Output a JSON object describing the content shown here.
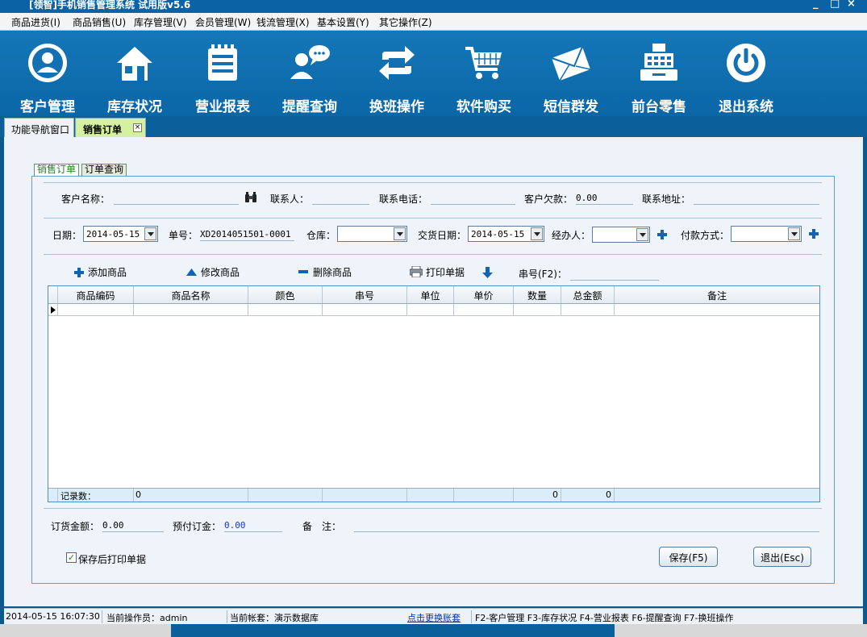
{
  "window": {
    "title": "[领智]手机销售管理系统 试用版v5.6",
    "controls": [
      "_",
      "□",
      "×"
    ]
  },
  "menu": [
    "商品进货(I)",
    "商品销售(U)",
    "库存管理(V)",
    "会员管理(W)",
    "钱流管理(X)",
    "基本设置(Y)",
    "其它操作(Z)"
  ],
  "toolbar": [
    {
      "label": "客户管理",
      "icon": "user-icon"
    },
    {
      "label": "库存状况",
      "icon": "home-icon"
    },
    {
      "label": "营业报表",
      "icon": "notebook-icon"
    },
    {
      "label": "提醒查询",
      "icon": "chat-user-icon"
    },
    {
      "label": "换班操作",
      "icon": "swap-icon"
    },
    {
      "label": "软件购买",
      "icon": "cart-icon"
    },
    {
      "label": "短信群发",
      "icon": "envelope-icon"
    },
    {
      "label": "前台零售",
      "icon": "cash-register-icon"
    },
    {
      "label": "退出系统",
      "icon": "power-icon"
    }
  ],
  "tabs": {
    "nav": "功能导航窗口",
    "active": "销售订单",
    "close": "×"
  },
  "inner_tabs": [
    "销售订单",
    "订单查询"
  ],
  "customer_row": {
    "customer_name_label": "客户名称：",
    "contact_label": "联系人：",
    "phone_label": "联系电话：",
    "debt_label": "客户欠款：",
    "debt_value": "0.00",
    "address_label": "联系地址："
  },
  "order_row": {
    "date_label": "日期：",
    "date_value": "2014-05-15",
    "order_no_label": "单号：",
    "order_no_value": "XD2014051501-0001",
    "warehouse_label": "仓库：",
    "delivery_label": "交货日期：",
    "delivery_value": "2014-05-15",
    "handler_label": "经办人：",
    "payment_label": "付款方式："
  },
  "actions": {
    "add": "添加商品",
    "edit": "修改商品",
    "delete": "删除商品",
    "print": "打印单据",
    "serial_label": "串号(F2)："
  },
  "grid": {
    "columns": [
      "商品编码",
      "商品名称",
      "颜色",
      "串号",
      "单位",
      "单价",
      "数量",
      "总金额",
      "备注"
    ],
    "footer": {
      "label": "记录数：",
      "count": "0",
      "qty_total": "0",
      "amount_total": "0"
    }
  },
  "totals": {
    "order_amount_label": "订货金额：",
    "order_amount_value": "0.00",
    "deposit_label": "预付订金：",
    "deposit_value": "0.00",
    "remark_label": "备　注："
  },
  "print_after_save": {
    "label": "保存后打印单据",
    "checked": true
  },
  "buttons": {
    "save": "保存(F5)",
    "exit": "退出(Esc)"
  },
  "status": {
    "datetime": "2014-05-15 16:07:30",
    "operator": "当前操作员：admin",
    "account": "当前帐套：演示数据库",
    "switch_link": "点击更换账套",
    "shortcuts": "F2-客户管理 F3-库存状况 F4-营业报表 F6-提醒查询 F7-换班操作"
  },
  "colors": {
    "toolbar_blue": "#0b66a6",
    "active_tab_green": "#d4f0a0",
    "panel_bg": "#eef4f9"
  }
}
